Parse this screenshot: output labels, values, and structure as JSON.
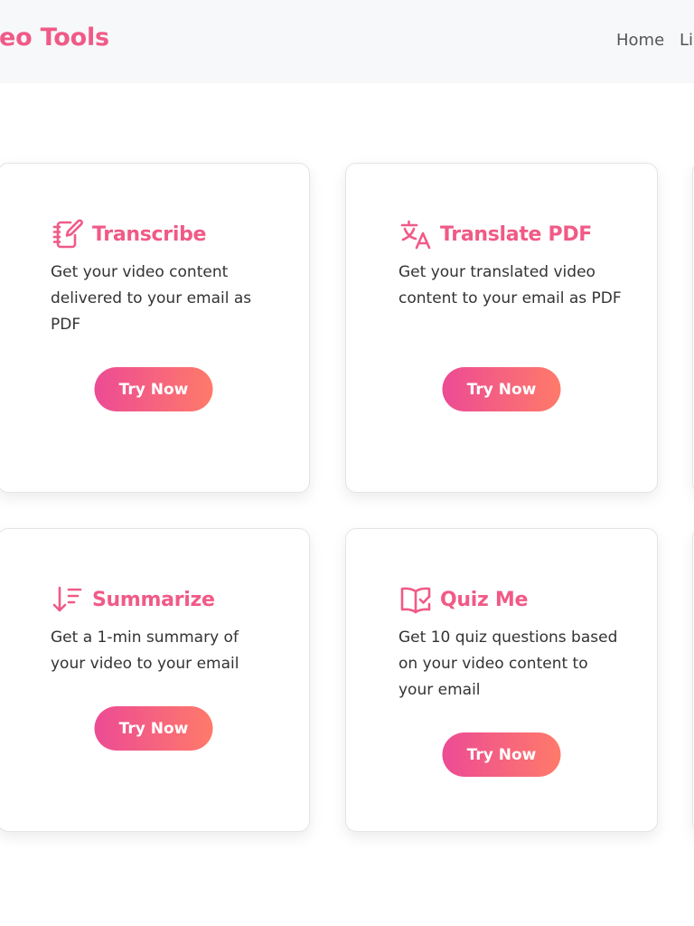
{
  "navbar": {
    "brand": "eo Tools",
    "links": [
      "Home",
      "Li"
    ]
  },
  "colors": {
    "accent": "#f05a87",
    "button_gradient_start": "#ec4b94",
    "button_gradient_end": "#ff7a6a",
    "nav_background": "#f7f8fa"
  },
  "cards": [
    {
      "icon": "notebook-edit-icon",
      "title": "Transcribe",
      "description": "Get your video content delivered to your email as PDF",
      "button_label": "Try Now"
    },
    {
      "icon": "translate-icon",
      "title": "Translate PDF",
      "description": "Get your translated video content to your email as PDF",
      "button_label": "Try Now"
    },
    {
      "icon": "sort-descending-icon",
      "title": "Summarize",
      "description": "Get a 1-min summary of your video to your email",
      "button_label": "Try Now"
    },
    {
      "icon": "book-check-icon",
      "title": "Quiz Me",
      "description": "Get 10 quiz questions based on your video content to your email",
      "button_label": "Try Now"
    }
  ]
}
